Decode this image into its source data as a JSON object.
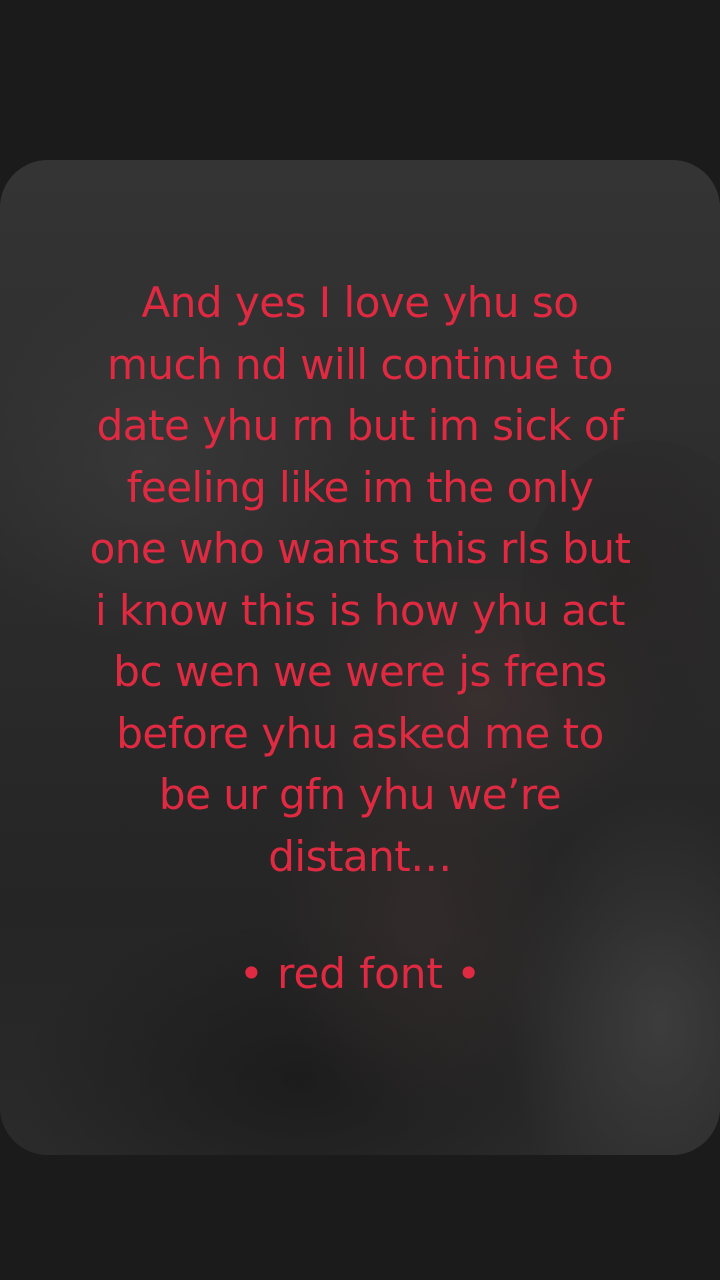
{
  "post": {
    "caption_lines": [
      "And yes I love yhu so",
      "much nd will continue to",
      "date yhu rn but im sick of",
      "feeling like im the only",
      "one who wants this rls but",
      "i know this is how yhu act",
      "bc wen we were js frens",
      "before yhu asked me to",
      "be ur gfn yhu we’re",
      "distant…"
    ],
    "tag": "• red font •",
    "text_color": "#e02a41",
    "background_color": "#1b1b1b"
  }
}
